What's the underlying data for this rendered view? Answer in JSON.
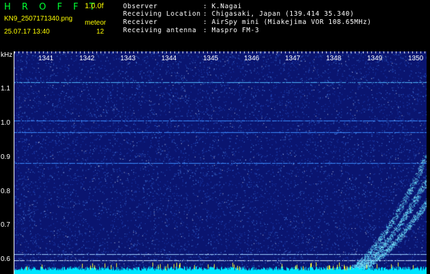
{
  "header": {
    "app_name": "H R O F F T",
    "version": "1.0.0f",
    "filename": "KN9_2507171340.png",
    "datetime": "25.07.17 13:40",
    "meteor_label": "meteor",
    "meteor_count": "12",
    "fields": [
      {
        "label": "Observer",
        "value": ": K.Nagai"
      },
      {
        "label": "Receiving Location",
        "value": ": Chigasaki, Japan (139.414 35.340)"
      },
      {
        "label": "Receiver",
        "value": ": AirSpy mini (Miakejima VOR 108.65MHz)"
      },
      {
        "label": "Receiving antenna",
        "value": ": Maspro FM-3"
      }
    ]
  },
  "axes": {
    "y_unit": "kHz",
    "y_ticks": [
      "1.1",
      "1.0",
      "0.9",
      "0.8",
      "0.7",
      "0.6"
    ],
    "x_ticks": [
      "1341",
      "1342",
      "1343",
      "1344",
      "1345",
      "1346",
      "1347",
      "1348",
      "1349",
      "1350"
    ]
  },
  "colors": {
    "background": "#000000",
    "plot_bg": "#0a1570",
    "title_green": "#00ff33",
    "label_yellow": "#ffff00",
    "noise": "#3a7cff",
    "signal": "#8ff0ff"
  }
}
